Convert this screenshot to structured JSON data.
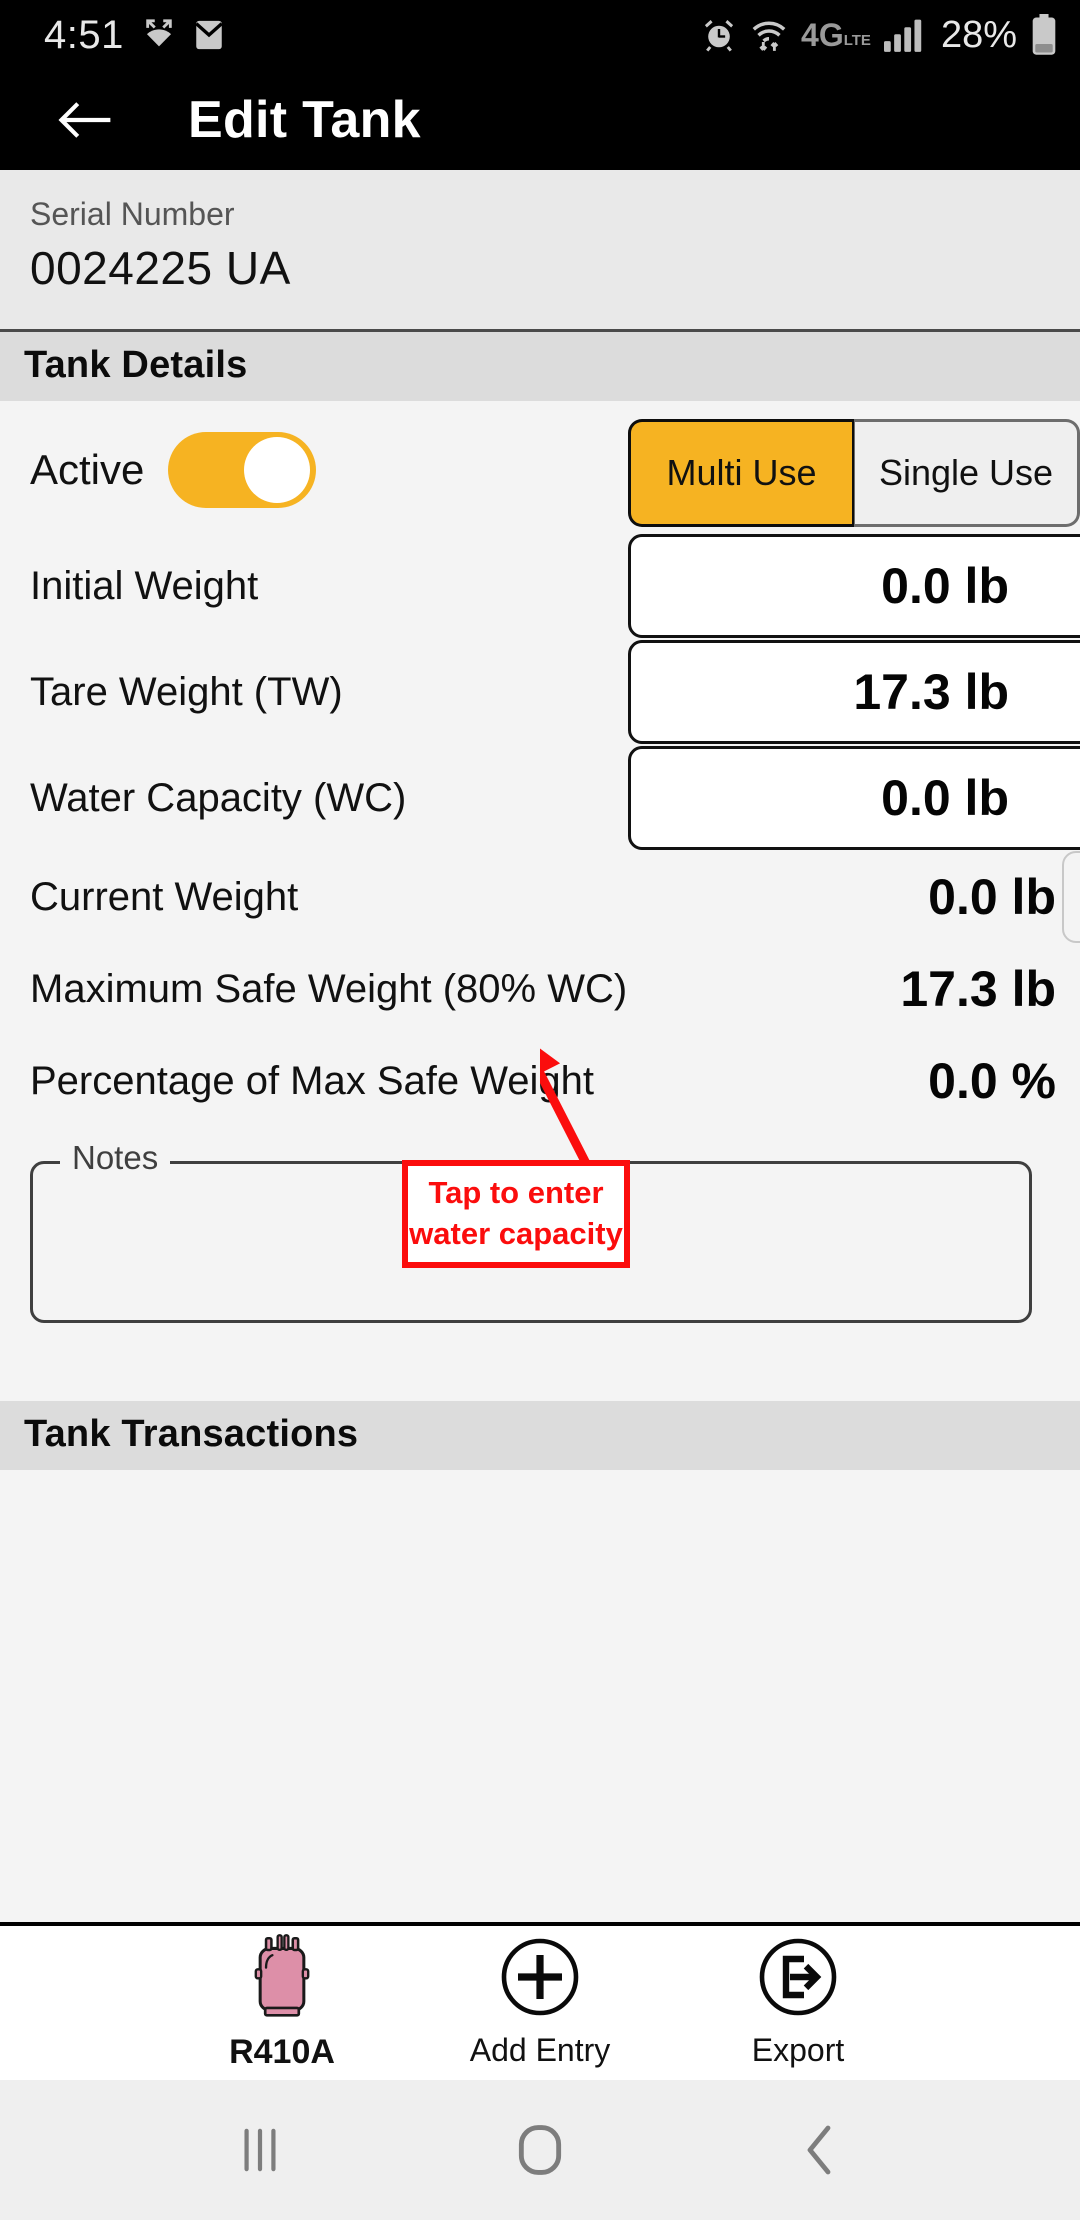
{
  "status_bar": {
    "time": "4:51",
    "battery_percent": "28%",
    "network": "4G",
    "network_sub": "LTE",
    "icons": [
      "missed-call-icon",
      "mail-icon",
      "alarm-icon",
      "wifi-icon",
      "network-4glte-icon",
      "signal-bars-icon",
      "battery-icon"
    ]
  },
  "appbar": {
    "title": "Edit Tank",
    "back_icon": "back-arrow-icon"
  },
  "serial": {
    "label": "Serial Number",
    "value": "0024225 UA"
  },
  "sections": {
    "tank_details": "Tank Details",
    "tank_transactions": "Tank Transactions"
  },
  "tank_details": {
    "active_label": "Active",
    "active_on": true,
    "usage_modes": {
      "multi_label": "Multi Use",
      "single_label": "Single Use",
      "selected": "Multi Use"
    },
    "fields": [
      {
        "label": "Initial Weight",
        "value": "0.0 lb",
        "editable": true
      },
      {
        "label": "Tare Weight (TW)",
        "value": "17.3 lb",
        "editable": true
      },
      {
        "label": "Water Capacity (WC)",
        "value": "0.0 lb",
        "editable": true
      },
      {
        "label": "Current Weight",
        "value": "0.0 lb",
        "editable": true
      },
      {
        "label": "Maximum Safe Weight (80% WC)",
        "value": "17.3 lb",
        "editable": false
      },
      {
        "label": "Percentage of Max Safe Weight",
        "value": "0.0 %",
        "editable": false
      }
    ],
    "notes": {
      "legend": "Notes",
      "value": ""
    }
  },
  "toolbar": {
    "items": [
      {
        "label": "R410A",
        "icon": "refrigerant-tank-icon"
      },
      {
        "label": "Add Entry",
        "icon": "plus-circle-icon"
      },
      {
        "label": "Export",
        "icon": "export-icon"
      }
    ]
  },
  "nav_bar": {
    "recents": "recents-icon",
    "home": "home-icon",
    "back": "back-icon"
  },
  "annotation": {
    "line1": "Tap to enter",
    "line2": "water capacity",
    "color": "#fb0d0d"
  },
  "colors": {
    "accent": "#f6b322",
    "appbar_bg": "#000000",
    "page_bg": "#f4f4f4",
    "section_bg": "#dcdcdc",
    "serial_bg": "#e9e9e9",
    "tank_icon": "#dd8fa8"
  }
}
